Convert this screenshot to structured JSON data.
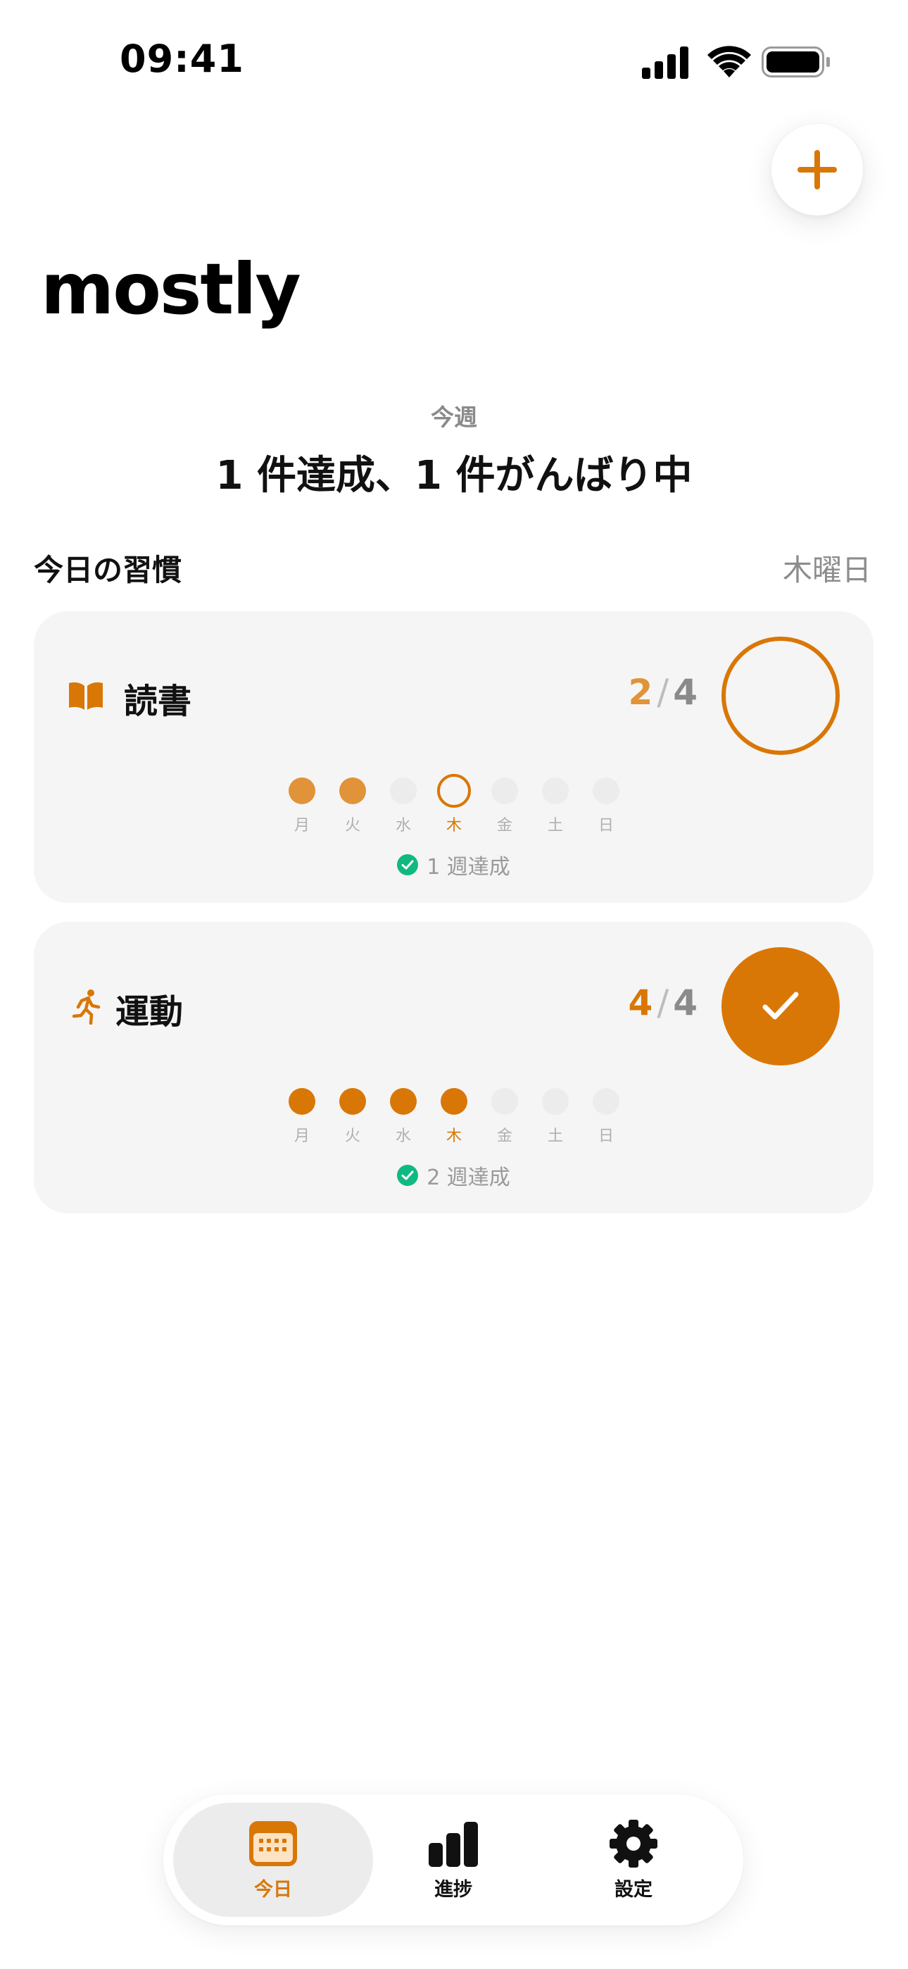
{
  "status_bar": {
    "time": "09:41"
  },
  "header": {
    "app_title": "mostly"
  },
  "week": {
    "label": "今週",
    "summary": "1 件達成、1 件がんばり中"
  },
  "section": {
    "title": "今日の習慣",
    "weekday": "木曜日"
  },
  "weekday_labels": [
    "月",
    "火",
    "水",
    "木",
    "金",
    "土",
    "日"
  ],
  "habits": [
    {
      "name": "読書",
      "icon": "book-icon",
      "done": "2",
      "total": "4",
      "checked_today": false,
      "days": [
        "past",
        "past",
        "none",
        "today",
        "none",
        "none",
        "none"
      ],
      "streak": "1 週達成"
    },
    {
      "name": "運動",
      "icon": "running-icon",
      "done": "4",
      "total": "4",
      "checked_today": true,
      "days": [
        "done",
        "done",
        "done",
        "done",
        "none",
        "none",
        "none"
      ],
      "streak": "2 週達成"
    }
  ],
  "tabs": [
    {
      "label": "今日",
      "icon": "calendar-icon",
      "active": true
    },
    {
      "label": "進捗",
      "icon": "bar-chart-icon",
      "active": false
    },
    {
      "label": "設定",
      "icon": "gear-icon",
      "active": false
    }
  ],
  "colors": {
    "accent": "#d97706",
    "accent_light": "#e09338",
    "success": "#10b981",
    "card_bg": "#f5f5f5"
  }
}
